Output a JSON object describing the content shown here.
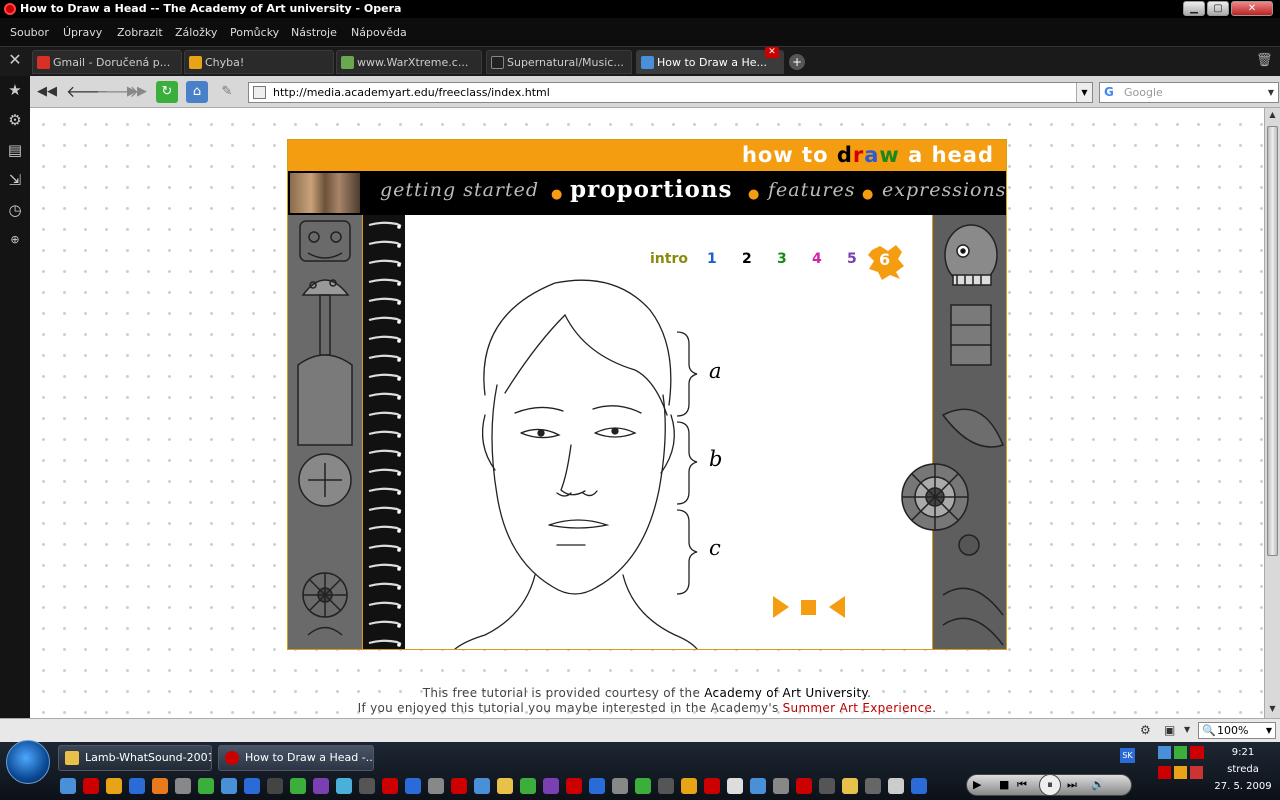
{
  "window": {
    "title": "How to Draw a Head -- The Academy of Art university - Opera"
  },
  "menu": [
    "Soubor",
    "Úpravy",
    "Zobrazit",
    "Záložky",
    "Pomůcky",
    "Nástroje",
    "Nápověda"
  ],
  "tabs": [
    {
      "label": "Gmail - Doručená p...",
      "color": "#d93025"
    },
    {
      "label": "Chyba!",
      "color": "#e8a317"
    },
    {
      "label": "www.WarXtreme.c...",
      "color": "#6aa84f"
    },
    {
      "label": "Supernatural/Music...",
      "color": "#222222"
    },
    {
      "label": "How to Draw a He...",
      "color": "#4a90d9"
    }
  ],
  "address": {
    "url": "http://media.academyart.edu/freeclass/index.html",
    "search_placeholder": "Google"
  },
  "tutorial": {
    "title_parts": [
      "how to ",
      "d",
      "r",
      "a",
      "w",
      " a head"
    ],
    "title_colors": [
      "#ffffff",
      "#000000",
      "#d40000",
      "#2b5bd7",
      "#1a8a1a",
      "#ffffff"
    ],
    "nav": [
      "getting started",
      "proportions",
      "features",
      "expressions"
    ],
    "current_nav": "proportions",
    "pages": [
      {
        "label": "intro",
        "color": "#8a8a10"
      },
      {
        "label": "1",
        "color": "#1e5fd6"
      },
      {
        "label": "2",
        "color": "#000000"
      },
      {
        "label": "3",
        "color": "#1a8a1a"
      },
      {
        "label": "4",
        "color": "#d41fb0"
      },
      {
        "label": "5",
        "color": "#7a3fb0"
      },
      {
        "label": "6",
        "color": "#ffffff"
      }
    ],
    "current_page": "6",
    "brace_labels": [
      "a",
      "b",
      "c"
    ],
    "accent": "#f59d10"
  },
  "credits": {
    "line1_pre": "This free tutorial is provided courtesy of the ",
    "line1_link": "Academy of Art University",
    "line1_post": ".",
    "line2_pre": "If you enjoyed this tutorial you maybe interested in the Academy's ",
    "line2_link": "Summer Art Experience",
    "line2_post": "."
  },
  "status": {
    "zoom": "100%"
  },
  "taskbar": {
    "tasks": [
      {
        "label": "Lamb-WhatSound-2001",
        "color": "#e8c14a"
      },
      {
        "label": "How to Draw a Head -...",
        "color": "#cc0000"
      }
    ],
    "lang": "SK",
    "time": "9:21",
    "day": "streda",
    "date": "27. 5. 2009"
  }
}
